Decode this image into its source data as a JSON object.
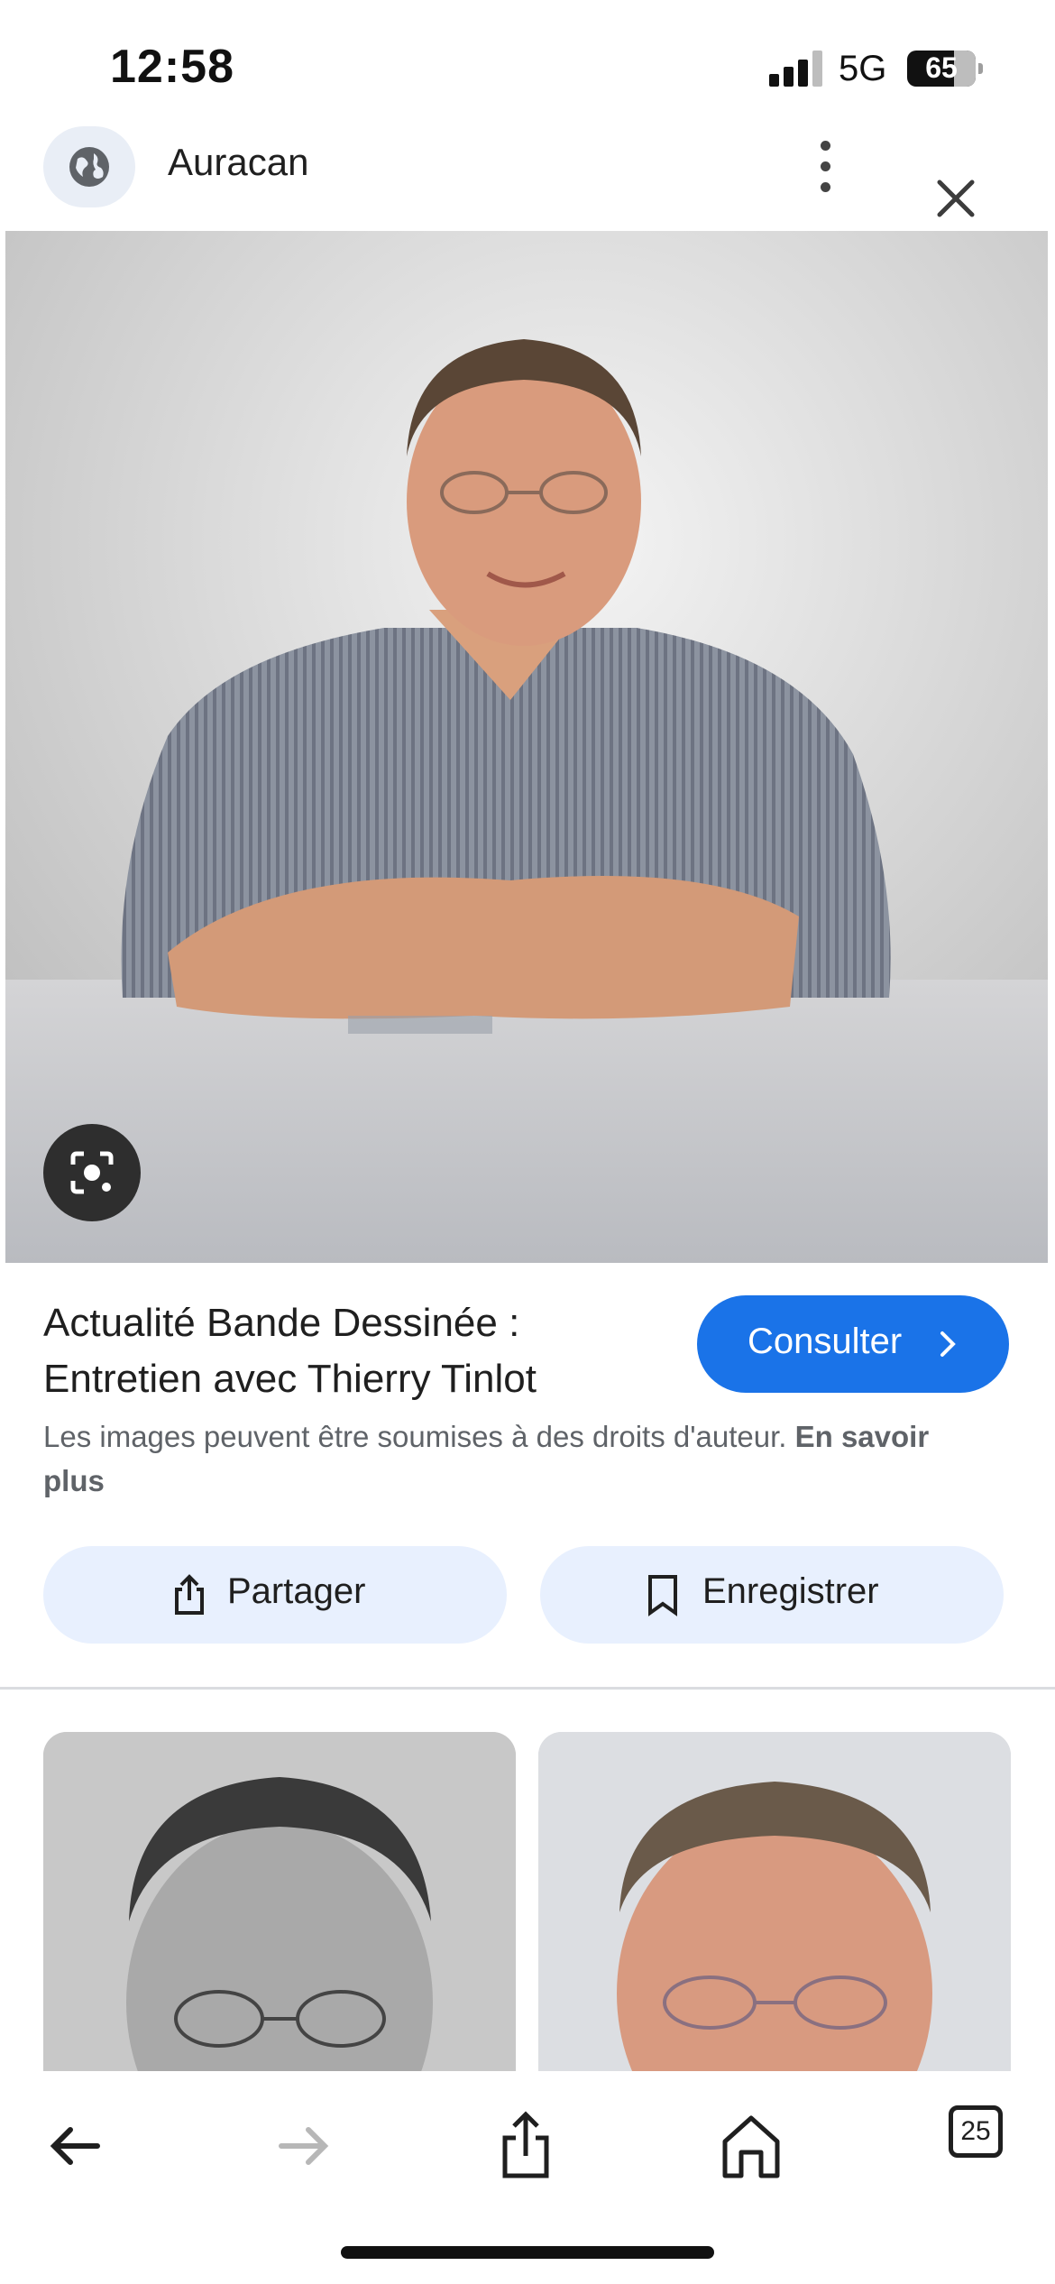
{
  "status_bar": {
    "time": "12:58",
    "network": "5G",
    "battery": "65"
  },
  "header": {
    "site_name": "Auracan"
  },
  "result": {
    "title": "Actualité Bande Dessinée : Entretien avec Thierry Tinlot",
    "consult_label": "Consulter",
    "copyright_text": "Les images peuvent être soumises à des droits d'auteur.",
    "learn_more": "En savoir plus"
  },
  "actions": {
    "share_label": "Partager",
    "save_label": "Enregistrer"
  },
  "toolbar": {
    "tabs_count": "25"
  },
  "colors": {
    "accent": "#1a73e8",
    "chip_bg": "#e8f0fe"
  },
  "icons": [
    "globe-icon",
    "more-vert-icon",
    "close-icon",
    "lens-icon",
    "chevron-right-icon",
    "share-icon",
    "bookmark-icon",
    "back-arrow-icon",
    "forward-arrow-icon",
    "home-icon",
    "tabs-icon"
  ]
}
